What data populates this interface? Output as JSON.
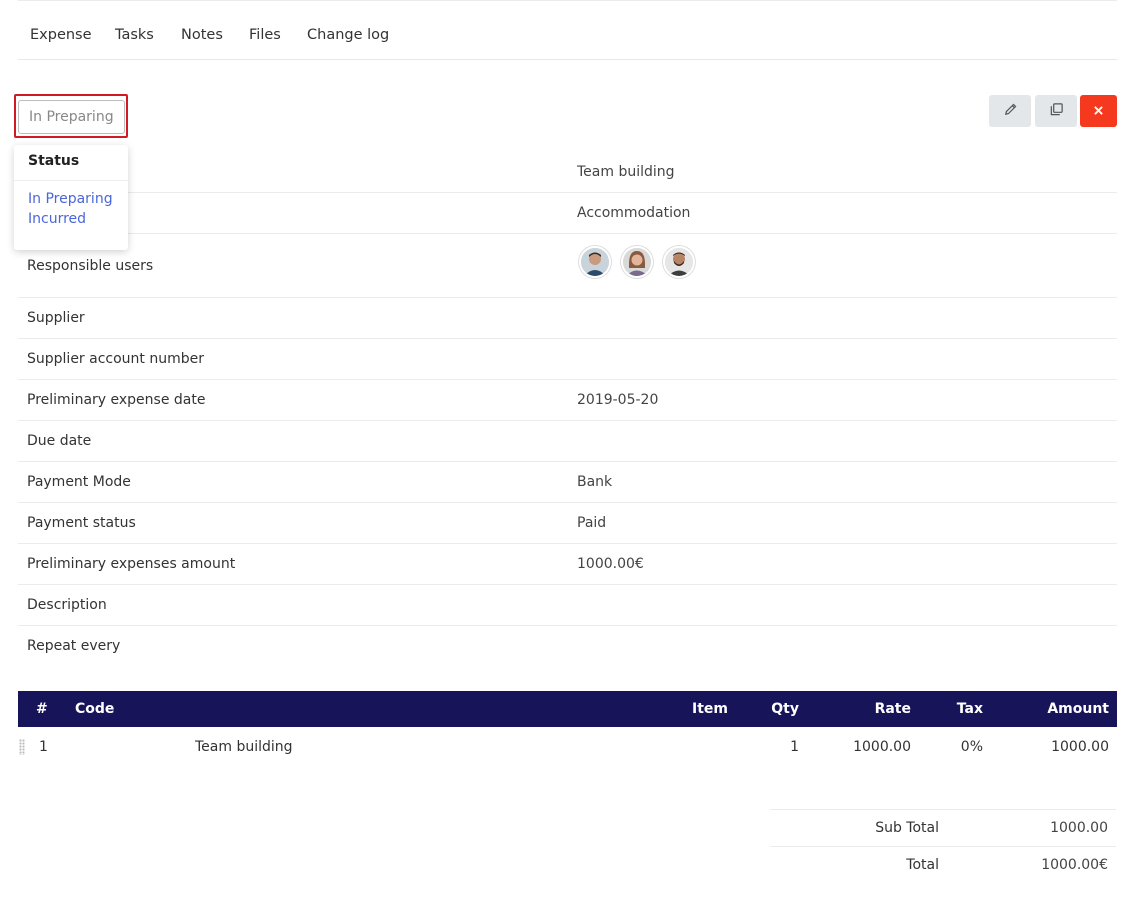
{
  "tabs": [
    "Expense",
    "Tasks",
    "Notes",
    "Files",
    "Change log"
  ],
  "status": {
    "current": "In Preparing",
    "dropdown_title": "Status",
    "options": [
      "In Preparing",
      "Incurred"
    ]
  },
  "actions": {
    "edit_icon": "pencil-icon",
    "copy_icon": "copy-icon",
    "delete_icon": "close-icon"
  },
  "details": [
    {
      "label": "",
      "value": "Team building"
    },
    {
      "label": "",
      "value": "Accommodation"
    },
    {
      "label": "Responsible users",
      "value": ""
    },
    {
      "label": "Supplier",
      "value": ""
    },
    {
      "label": "Supplier account number",
      "value": ""
    },
    {
      "label": "Preliminary expense date",
      "value": "2019-05-20"
    },
    {
      "label": "Due date",
      "value": ""
    },
    {
      "label": "Payment Mode",
      "value": "Bank"
    },
    {
      "label": "Payment status",
      "value": "Paid"
    },
    {
      "label": "Preliminary expenses amount",
      "value": "1000.00€"
    },
    {
      "label": "Description",
      "value": ""
    },
    {
      "label": "Repeat every",
      "value": ""
    }
  ],
  "items_table": {
    "headers": [
      "#",
      "Code",
      "Item",
      "Qty",
      "Rate",
      "Tax",
      "Amount"
    ],
    "rows": [
      {
        "num": "1",
        "code": "Team building",
        "item": "",
        "qty": "1",
        "rate": "1000.00",
        "tax": "0%",
        "amount": "1000.00"
      }
    ]
  },
  "totals": [
    {
      "label": "Sub Total",
      "value": "1000.00"
    },
    {
      "label": "Total",
      "value": "1000.00€"
    }
  ],
  "colors": {
    "table_header": "#17145a",
    "link": "#4a66d8",
    "danger": "#f4391f",
    "highlight": "#d21a24"
  }
}
